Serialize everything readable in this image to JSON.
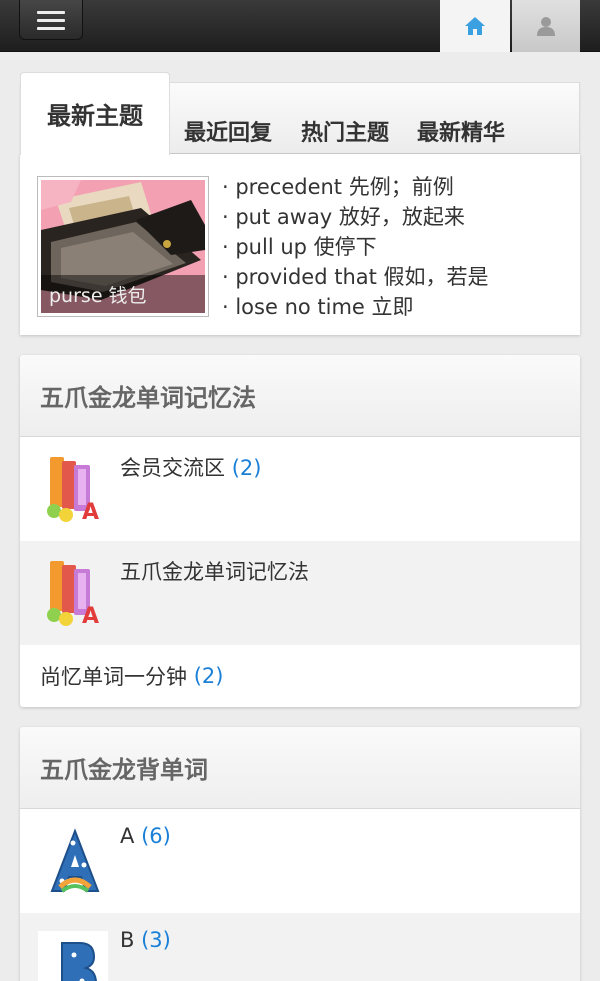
{
  "header": {
    "menu_icon": "menu-icon",
    "home_icon": "home-icon",
    "user_icon": "user-icon",
    "accent": "#3aa0e0"
  },
  "tabs": [
    "最新主题",
    "最近回复",
    "热门主题",
    "最新精华"
  ],
  "featured": {
    "caption": "purse 钱包"
  },
  "recent_topics": [
    "· precedent 先例；前例",
    "· put away 放好，放起来",
    "· pull up 使停下",
    "· provided that 假如，若是",
    "· lose no time 立即"
  ],
  "section1": {
    "title": "五爪金龙单词记忆法",
    "forums": [
      {
        "name": "会员交流区",
        "count": "(2)",
        "icon": "books-icon"
      },
      {
        "name": "五爪金龙单词记忆法",
        "count": "",
        "icon": "books-icon"
      }
    ],
    "plain": {
      "name": "尚忆单词一分钟",
      "count": "(2)"
    }
  },
  "section2": {
    "title": "五爪金龙背单词",
    "forums": [
      {
        "name": "A",
        "count": "(6)",
        "icon": "letter-a-icon"
      },
      {
        "name": "B",
        "count": "(3)",
        "icon": "letter-b-icon"
      }
    ]
  }
}
